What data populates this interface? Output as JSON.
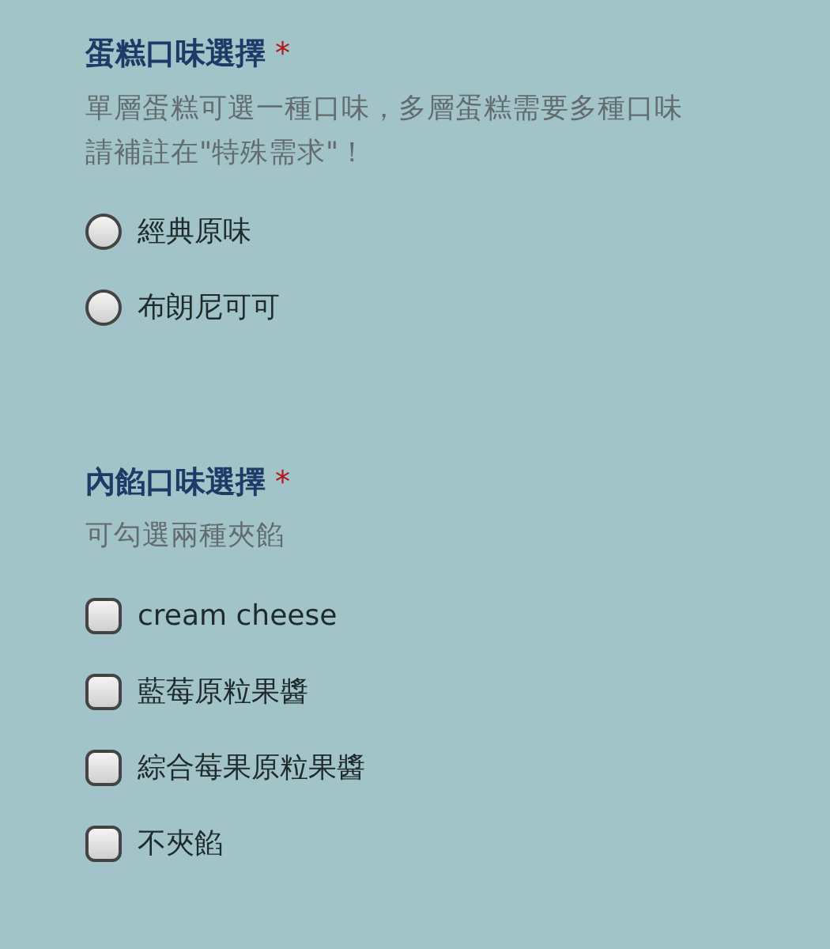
{
  "questions": [
    {
      "title": "蛋糕口味選擇",
      "required_mark": "*",
      "description": [
        "單層蛋糕可選一種口味，多層蛋糕需要多種口味",
        "請補註在\"特殊需求\"！"
      ],
      "kind": "radio",
      "options": [
        {
          "label": "經典原味",
          "selected": false
        },
        {
          "label": "布朗尼可可",
          "selected": false
        }
      ]
    },
    {
      "title": "內餡口味選擇",
      "required_mark": "*",
      "description": [
        "可勾選兩種夾餡"
      ],
      "kind": "checkbox",
      "options": [
        {
          "label": "cream cheese",
          "checked": false
        },
        {
          "label": "藍莓原粒果醬",
          "checked": false
        },
        {
          "label": "綜合莓果原粒果醬",
          "checked": false
        },
        {
          "label": "不夾餡",
          "checked": false
        }
      ]
    }
  ]
}
